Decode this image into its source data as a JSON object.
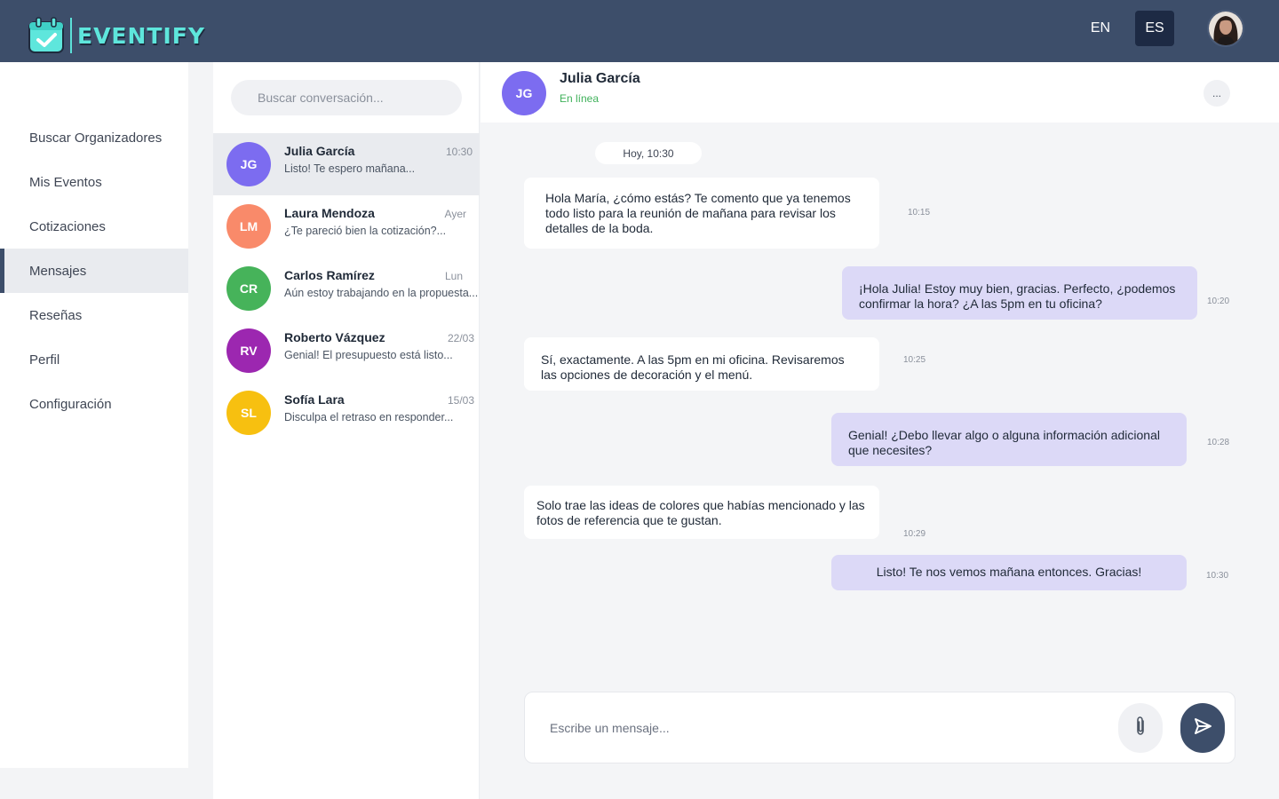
{
  "app": {
    "name": "EVENTIFY",
    "brand_color": "#5ee6dc",
    "header_color": "#3d4e6a"
  },
  "header": {
    "languages": [
      "EN",
      "ES"
    ],
    "selected_language": "ES"
  },
  "sidebar": {
    "items": [
      {
        "label": "Buscar Organizadores"
      },
      {
        "label": "Mis Eventos"
      },
      {
        "label": "Cotizaciones"
      },
      {
        "label": "Mensajes",
        "active": true
      },
      {
        "label": "Reseñas"
      },
      {
        "label": "Perfil"
      },
      {
        "label": "Configuración"
      }
    ]
  },
  "conversations": {
    "search_placeholder": "Buscar conversación...",
    "items": [
      {
        "initials": "JG",
        "name": "Julia García",
        "time": "10:30",
        "preview": "Listo! Te espero mañana...",
        "color": "#7c6cf0",
        "active": true
      },
      {
        "initials": "LM",
        "name": "Laura Mendoza",
        "time": "Ayer",
        "preview": "¿Te pareció bien la cotización?...",
        "color": "#f98a6a"
      },
      {
        "initials": "CR",
        "name": "Carlos Ramírez",
        "time": "Lun",
        "preview": "Aún estoy trabajando en la propuesta...",
        "color": "#46b35a"
      },
      {
        "initials": "RV",
        "name": "Roberto Vázquez",
        "time": "22/03",
        "preview": "Genial! El presupuesto está listo...",
        "color": "#9c27b0"
      },
      {
        "initials": "SL",
        "name": "Sofía Lara",
        "time": "15/03",
        "preview": "Disculpa el retraso en responder...",
        "color": "#f7c010"
      }
    ]
  },
  "chat": {
    "contact_initials": "JG",
    "contact_name": "Julia García",
    "status": "En línea",
    "more_label": "...",
    "date_divider": "Hoy, 10:30",
    "messages": [
      {
        "direction": "in",
        "text": "Hola María, ¿cómo estás? Te comento que ya tenemos todo listo para la reunión de mañana para revisar los detalles de la boda.",
        "time": "10:15"
      },
      {
        "direction": "out",
        "text": "¡Hola Julia! Estoy muy bien, gracias. Perfecto, ¿podemos confirmar la hora? ¿A las 5pm en tu oficina?",
        "time": "10:20"
      },
      {
        "direction": "in",
        "text": "Sí, exactamente. A las 5pm en mi oficina. Revisaremos las opciones de decoración y el menú.",
        "time": "10:25"
      },
      {
        "direction": "out",
        "text": "Genial! ¿Debo llevar algo o alguna información adicional que necesites?",
        "time": "10:28"
      },
      {
        "direction": "in",
        "text": "Solo trae las ideas de colores que habías mencionado y las fotos de referencia que te gustan.",
        "time": "10:29"
      },
      {
        "direction": "out",
        "text": "Listo! Te nos vemos mañana entonces. Gracias!",
        "time": "10:30"
      }
    ],
    "composer_placeholder": "Escribe un mensaje..."
  }
}
